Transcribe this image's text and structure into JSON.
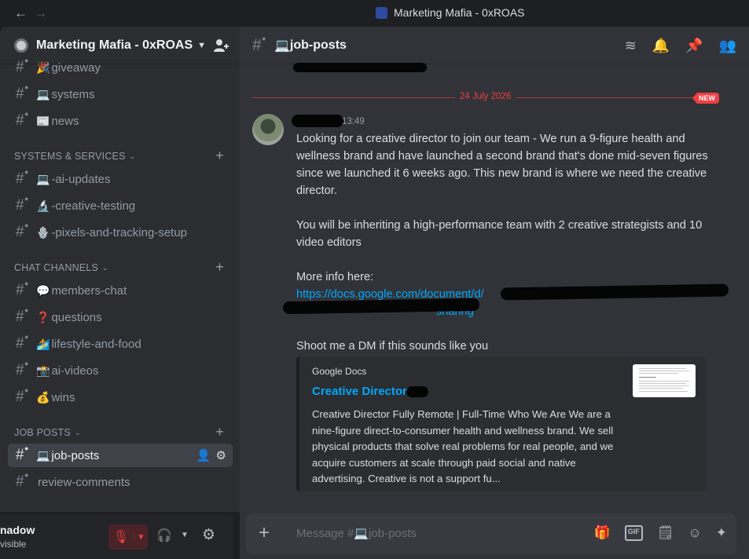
{
  "titlebar": {
    "back_icon": "←",
    "forward_icon": "→",
    "window_title": "Marketing Mafia - 0xROAS"
  },
  "server": {
    "name": "Marketing Mafia - 0xROAS"
  },
  "channels": {
    "giveaway": {
      "emoji": "🎉",
      "label": "giveaway"
    },
    "systems": {
      "emoji": "💻",
      "label": "systems"
    },
    "news": {
      "emoji": "📰",
      "label": "news"
    },
    "cat_systems": "SYSTEMS & SERVICES",
    "ai_updates": {
      "emoji": "💻",
      "label": "-ai-updates"
    },
    "creative_testing": {
      "emoji": "🔬",
      "label": "-creative-testing"
    },
    "pixels": {
      "emoji": "🪬",
      "label": "-pixels-and-tracking-setup"
    },
    "cat_chat": "CHAT CHANNELS",
    "members_chat": {
      "emoji": "💬",
      "label": "members-chat"
    },
    "questions": {
      "emoji": "❓",
      "label": "questions"
    },
    "lifestyle": {
      "emoji": "🏄",
      "label": "lifestyle-and-food"
    },
    "ai_videos": {
      "emoji": "📸",
      "label": "ai-videos"
    },
    "wins": {
      "emoji": "💰",
      "label": "wins"
    },
    "cat_jobs": "JOB POSTS",
    "job_posts": {
      "emoji": "💻",
      "label": "job-posts"
    },
    "review_comments": {
      "emoji": "",
      "label": "review-comments"
    }
  },
  "user": {
    "name": "nadow",
    "status": "visible"
  },
  "chat": {
    "channel_emoji": "💻",
    "channel_name": "job-posts",
    "divider_date": "24 July 2026",
    "new_badge": "NEW",
    "timestamp": "13:49",
    "lines": [
      "Looking for a creative director to join our team - We run a 9-figure health and wellness brand and have launched a second brand that's done mid-seven figures since we launched it 6 weeks ago. This new brand is where we need the creative director.",
      "You will be inheriting a high-performance team with 2 creative strategists and 10 video editors",
      "More info here:",
      "Shoot me a DM if this sounds like you"
    ],
    "link_start": "https://docs.google.com/document/d/",
    "link_end": "sharing",
    "embed": {
      "provider": "Google Docs",
      "title": "Creative Director",
      "description": "Creative Director Fully Remote | Full-Time Who We Are We are a nine-figure direct-to-consumer health and wellness brand. We sell physical products that solve real problems for real people, and we acquire customers at scale through paid social and native advertising. Creative is not a support fu..."
    },
    "composer_placeholder": "Message #💻job-posts"
  }
}
